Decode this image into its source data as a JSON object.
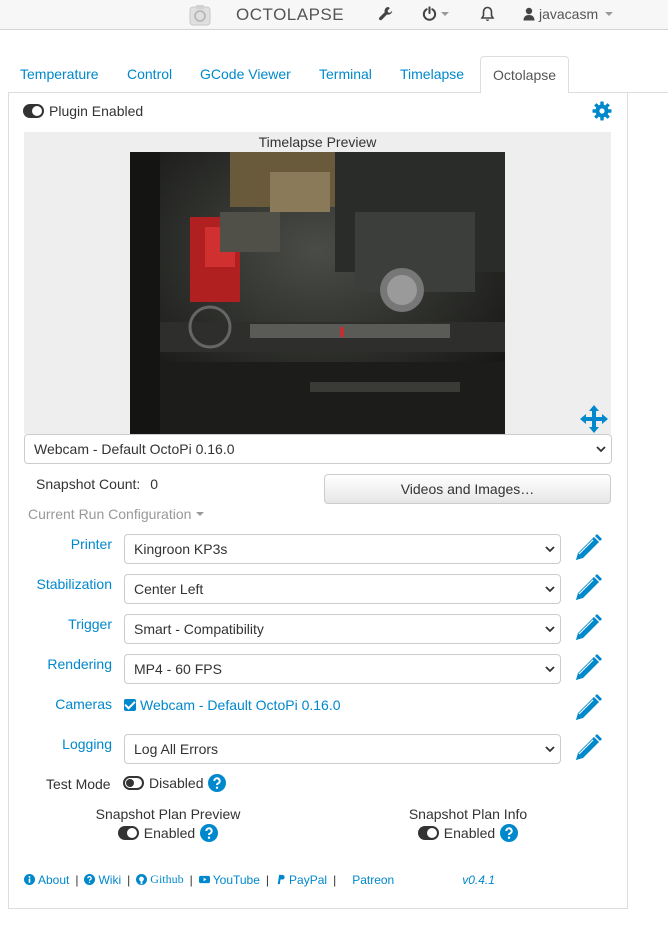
{
  "navbar": {
    "brand": "OCTOLAPSE",
    "user": "javacasm",
    "icons": [
      "octoprint-logo-icon",
      "wrench-icon",
      "power-icon",
      "bell-icon",
      "user-icon"
    ]
  },
  "tabs": [
    {
      "label": "Temperature",
      "active": false
    },
    {
      "label": "Control",
      "active": false
    },
    {
      "label": "GCode Viewer",
      "active": false
    },
    {
      "label": "Terminal",
      "active": false
    },
    {
      "label": "Timelapse",
      "active": false
    },
    {
      "label": "Octolapse",
      "active": true
    }
  ],
  "plugin": {
    "enabled_label": "Plugin Enabled",
    "enabled": true
  },
  "preview": {
    "title": "Timelapse Preview",
    "camera_select": "Webcam - Default OctoPi 0.16.0"
  },
  "snapshot": {
    "count_label": "Snapshot Count:",
    "count": "0",
    "videos_button": "Videos and Images…"
  },
  "run_config": {
    "label": "Current Run Configuration"
  },
  "settings": {
    "printer": {
      "label": "Printer",
      "value": "Kingroon KP3s"
    },
    "stabilization": {
      "label": "Stabilization",
      "value": "Center Left"
    },
    "trigger": {
      "label": "Trigger",
      "value": "Smart - Compatibility"
    },
    "rendering": {
      "label": "Rendering",
      "value": "MP4 - 60 FPS"
    },
    "cameras": {
      "label": "Cameras",
      "value": "Webcam - Default OctoPi 0.16.0",
      "checked": true
    },
    "logging": {
      "label": "Logging",
      "value": "Log All Errors"
    }
  },
  "test_mode": {
    "label": "Test Mode",
    "value": "Disabled",
    "enabled": false
  },
  "snapshot_plan_preview": {
    "title": "Snapshot Plan Preview",
    "value": "Enabled",
    "enabled": true
  },
  "snapshot_plan_info": {
    "title": "Snapshot Plan Info",
    "value": "Enabled",
    "enabled": true
  },
  "footer": {
    "about": "About",
    "wiki": "Wiki",
    "github": "Github",
    "youtube": "YouTube",
    "paypal": "PayPal",
    "patreon": "Patreon",
    "version": "v0.4.1"
  },
  "colors": {
    "link": "#0088cc",
    "muted": "#999999",
    "navbar_bg": "#f7f7f7"
  }
}
